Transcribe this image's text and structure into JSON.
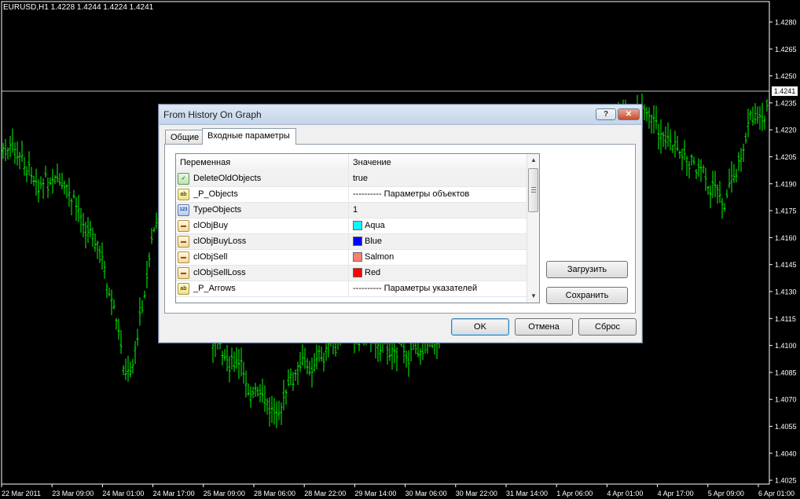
{
  "chart": {
    "title": "EURUSD,H1  1.4228 1.4244 1.4224 1.4241",
    "current_price": "1.4241",
    "price_labels": [
      "1.4280",
      "1.4265",
      "1.4250",
      "1.4235",
      "1.4220",
      "1.4205",
      "1.4190",
      "1.4175",
      "1.4160",
      "1.4145",
      "1.4130",
      "1.4115",
      "1.4100",
      "1.4085",
      "1.4070",
      "1.4055",
      "1.4040",
      "1.4025"
    ],
    "time_labels": [
      "22 Mar 2011",
      "23 Mar 09:00",
      "24 Mar 01:00",
      "24 Mar 17:00",
      "25 Mar 09:00",
      "28 Mar 06:00",
      "28 Mar 22:00",
      "29 Mar 14:00",
      "30 Mar 06:00",
      "30 Mar 22:00",
      "31 Mar 14:00",
      "1 Apr 06:00",
      "4 Apr 01:00",
      "4 Apr 17:00",
      "5 Apr 09:00",
      "6 Apr 01:00"
    ],
    "bar_color": "#00ff00"
  },
  "dialog": {
    "title": "From History On Graph",
    "help_label": "?",
    "close_label": "✕",
    "tabs": [
      "Общие",
      "Входные параметры"
    ],
    "columns": {
      "variable": "Переменная",
      "value": "Значение"
    },
    "params": [
      {
        "icon": "bool-icon",
        "name": "DeleteOldObjects",
        "value": "true"
      },
      {
        "icon": "string-icon",
        "name": "_P_Objects",
        "value": "---------- Параметры объектов"
      },
      {
        "icon": "int-icon",
        "name": "TypeObjects",
        "value": "1"
      },
      {
        "icon": "color-icon",
        "name": "clObjBuy",
        "value": "Aqua",
        "color": "#00ffff"
      },
      {
        "icon": "color-icon",
        "name": "clObjBuyLoss",
        "value": "Blue",
        "color": "#0000ff"
      },
      {
        "icon": "color-icon",
        "name": "clObjSell",
        "value": "Salmon",
        "color": "#fa8072"
      },
      {
        "icon": "color-icon",
        "name": "clObjSellLoss",
        "value": "Red",
        "color": "#ff0000"
      },
      {
        "icon": "string-icon",
        "name": "_P_Arrows",
        "value": "---------- Параметры указателей"
      }
    ],
    "buttons": {
      "load": "Загрузить",
      "save": "Сохранить",
      "ok": "OK",
      "cancel": "Отмена",
      "reset": "Сброс"
    }
  }
}
